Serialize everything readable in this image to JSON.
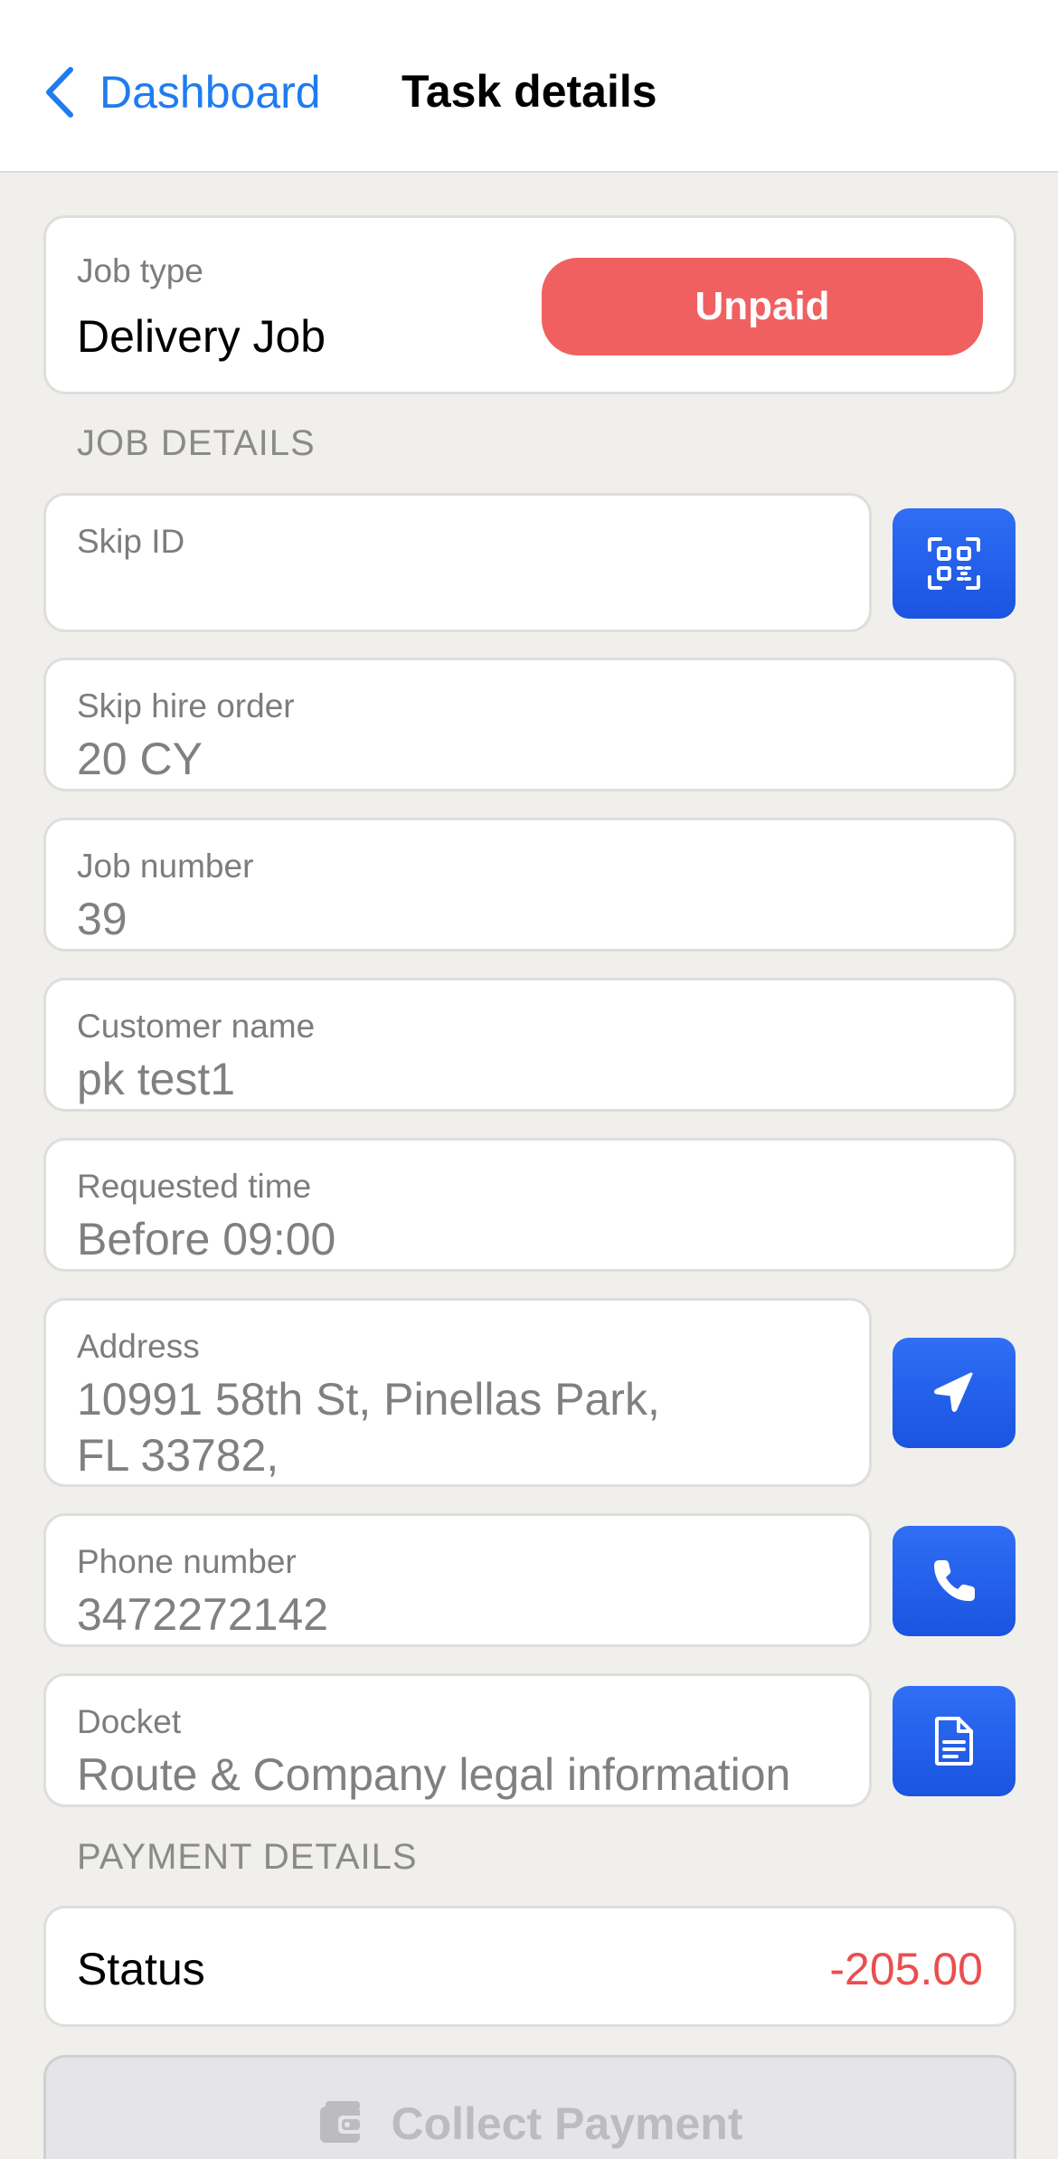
{
  "navbar": {
    "back_label": "Dashboard",
    "title": "Task details"
  },
  "job_type": {
    "label": "Job type",
    "value": "Delivery Job",
    "badge": "Unpaid"
  },
  "sections": {
    "job_details": "JOB DETAILS",
    "payment_details": "PAYMENT DETAILS"
  },
  "fields": {
    "skip_id": {
      "label": "Skip ID",
      "value": ""
    },
    "skip_hire_order": {
      "label": "Skip hire order",
      "value": "20 CY"
    },
    "job_number": {
      "label": "Job number",
      "value": "39"
    },
    "customer_name": {
      "label": "Customer name",
      "value": "pk test1"
    },
    "requested_time": {
      "label": "Requested time",
      "value": "Before 09:00"
    },
    "address": {
      "label": "Address",
      "line1": "10991 58th St, Pinellas Park,",
      "line2": "FL 33782,"
    },
    "phone_number": {
      "label": "Phone number",
      "value": "3472272142"
    },
    "docket": {
      "label": "Docket",
      "value": "Route & Company legal information"
    }
  },
  "payment": {
    "status_label": "Status",
    "amount": "-205.00",
    "collect_label": "Collect Payment"
  },
  "colors": {
    "accent": "#1f7cf0",
    "button_blue": "#2563eb",
    "unpaid": "#f06060",
    "negative": "#ea4e4e"
  },
  "icons": [
    "chevron-left-icon",
    "qr-code-icon",
    "navigation-arrow-icon",
    "phone-icon",
    "document-icon",
    "wallet-icon"
  ]
}
